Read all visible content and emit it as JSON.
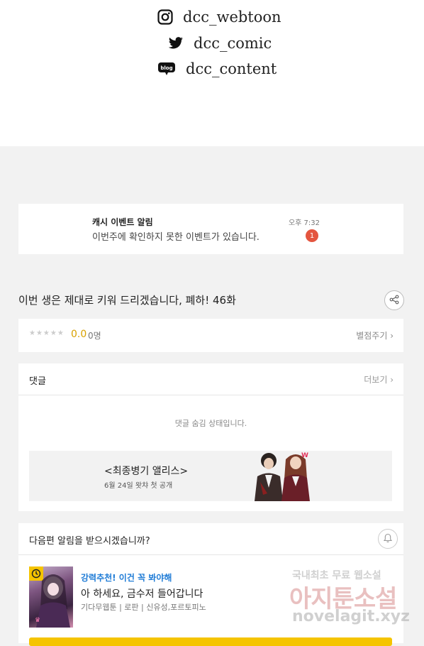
{
  "social": {
    "instagram": "dcc_webtoon",
    "twitter": "dcc_comic",
    "blog": "dcc_content",
    "blog_icon_text": "blog"
  },
  "notice": {
    "title": "캐시 이벤트 알림",
    "body": "이번주에 확인하지 못한 이벤트가 있습니다.",
    "time": "오후 7:32",
    "badge": "1"
  },
  "episode": {
    "title": "이번 생은 제대로 키워 드리겠습니다, 폐하! 46화"
  },
  "rating": {
    "stars": "★★★★★",
    "value": "0.0",
    "count": "0명",
    "rate_link": "별점주기 ›"
  },
  "comments": {
    "title": "댓글",
    "more": "더보기 ›",
    "hidden_msg": "댓글 숨김 상태입니다."
  },
  "banner": {
    "title": "<최종병기 앨리스>",
    "subtitle": "6월 24일 왓챠 첫 공개",
    "logo_text": "W"
  },
  "next_alert": {
    "title": "다음편 알림을 받으시겠습니까?"
  },
  "recommend": {
    "tag": "강력추천! 이건 꼭 봐야해",
    "title": "아 하세요, 금수저 들어갑니다",
    "meta": "기다무웹툰 | 로판 | 신유성,포르토피노"
  },
  "watermark": {
    "line1": "국내최초 무료 웹소설",
    "line2": "아지툰소설",
    "line3": "novelagit.xyz"
  },
  "colors": {
    "accent_yellow": "#f5c400",
    "badge_red": "#e4553f",
    "link_blue": "#1e7bd6"
  }
}
